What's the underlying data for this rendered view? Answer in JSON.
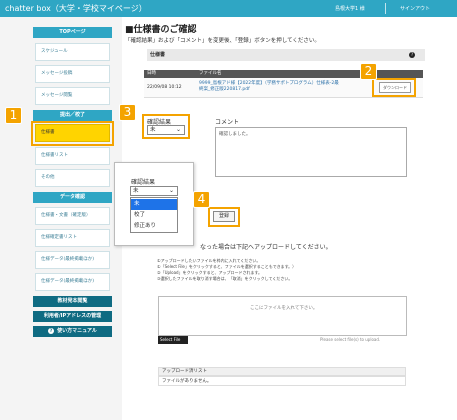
{
  "header": {
    "brand": "chatter box（大学・学校マイページ）",
    "user": "島根大学1 様",
    "logout": "サインアウト"
  },
  "sidebar": {
    "section1": "TOPページ",
    "items1": [
      "スケジュール",
      "メッセージ投稿",
      "メッセージ閲覧"
    ],
    "section2": "提出／校了",
    "items2": [
      "仕様書",
      "仕様書リスト",
      "その他"
    ],
    "section3": "データ確認",
    "items3": [
      "仕様書・文書（確定版）",
      "仕様確定書リスト",
      "仕様データ(最終掲載ほか)",
      "仕様データ(最終掲載ほか)"
    ],
    "section4": "教材発本閲覧",
    "section5": "利用者/IPアドレスの管理",
    "section6": "使い方マニュアル"
  },
  "main": {
    "title": "■仕様書のご確認",
    "desc": "「確認結果」および「コメント」を変更後、「登録」ボタンを押してください。",
    "panel_title": "仕様書",
    "help": "?",
    "table": {
      "col_date": "日時",
      "col_file": "ファイル名",
      "row_date": "22/09/08 10:12",
      "row_file": "9999_島根アド様【2022年度】（学務サポトプログラム）仕様表-2最終案_修正版220817.pdf",
      "download": "ダウンロード"
    },
    "status_label": "確認結果",
    "status_value": "未",
    "comment_label": "コメント",
    "comment_value": "確認しました。",
    "popover_label": "確認結果",
    "popover_value": "未",
    "options": [
      "未",
      "校了",
      "修正あり"
    ],
    "submit": "登録",
    "upload_desc": "なった場合は下記へアップロードしてください。",
    "notes": [
      "①アップロードしたいファイルを枠内に入れてください。",
      "①「Select File」をクリックすると、ファイルを選択することもできます。）",
      "②「Upload」をクリックすると、アップロードされます。",
      "③選択したファイルを取り消す場合は、「取消」をクリックしてください。"
    ],
    "dropzone": "ここにファイルを入れて下さい。",
    "select_file": "Select File",
    "select_hint": "Please select file(s) to upload.",
    "list_title": "アップロード済リスト",
    "list_empty": "ファイルがありません。"
  },
  "badges": [
    "1",
    "2",
    "3",
    "4"
  ],
  "colors": {
    "header": "#2fa6c4",
    "sidebar_dark": "#0f6b82",
    "highlight": "#f4a300",
    "active": "#ffd400",
    "selected_option": "#1e73e8"
  }
}
